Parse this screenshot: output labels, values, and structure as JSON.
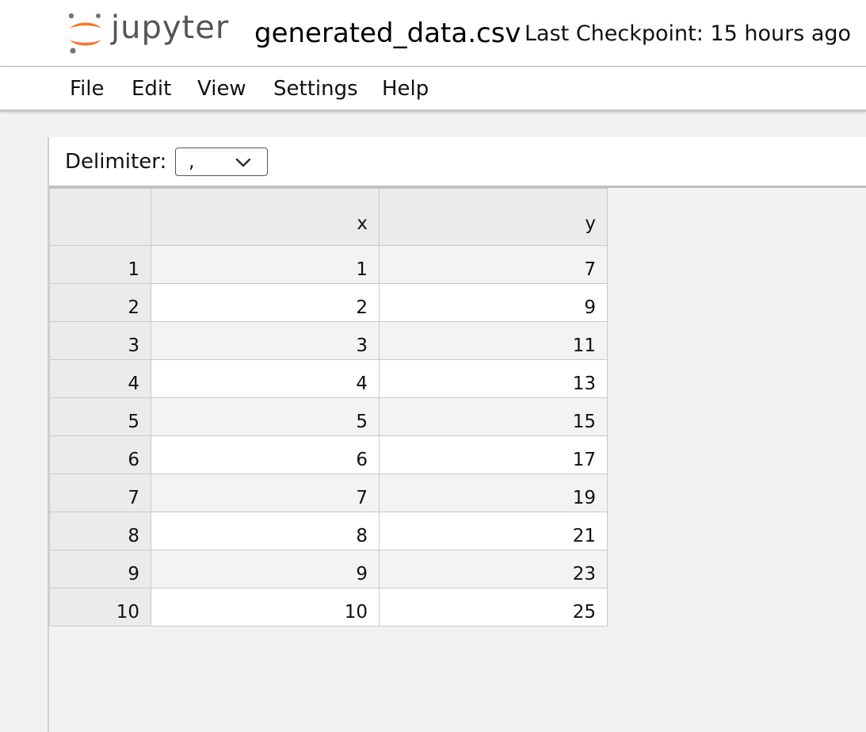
{
  "header": {
    "logo_text": "jupyter",
    "document_title": "generated_data.csv",
    "checkpoint": "Last Checkpoint: 15 hours ago"
  },
  "menu": [
    "File",
    "Edit",
    "View",
    "Settings",
    "Help"
  ],
  "toolbar": {
    "delimiter_label": "Delimiter:",
    "delimiter_value": ","
  },
  "grid": {
    "columns": [
      "",
      "x",
      "y"
    ],
    "rows": [
      [
        "1",
        "1",
        "7"
      ],
      [
        "2",
        "2",
        "9"
      ],
      [
        "3",
        "3",
        "11"
      ],
      [
        "4",
        "4",
        "13"
      ],
      [
        "5",
        "5",
        "15"
      ],
      [
        "6",
        "6",
        "17"
      ],
      [
        "7",
        "7",
        "19"
      ],
      [
        "8",
        "8",
        "21"
      ],
      [
        "9",
        "9",
        "23"
      ],
      [
        "10",
        "10",
        "25"
      ]
    ]
  },
  "colors": {
    "logo_orange": "#f37726",
    "logo_gray": "#767677"
  },
  "icons": [
    "jupyter-logo-icon",
    "chevron-down-icon"
  ]
}
